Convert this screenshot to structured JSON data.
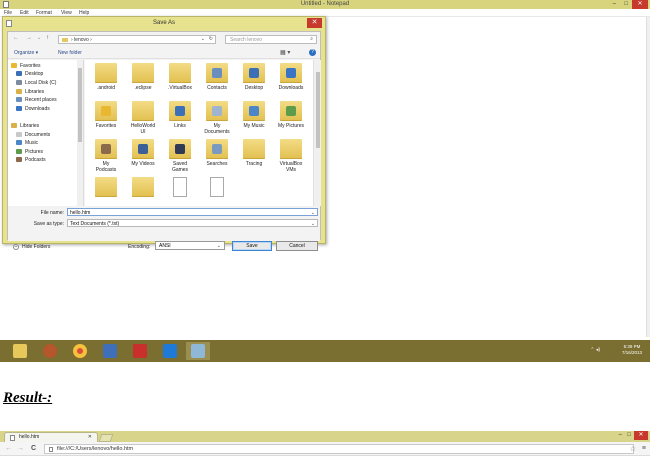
{
  "notepad": {
    "title": "Untitled - Notepad",
    "menu": [
      "File",
      "Edit",
      "Format",
      "View",
      "Help"
    ],
    "window_controls": {
      "minimize": "–",
      "maximize": "□",
      "close": "✕"
    }
  },
  "dialog": {
    "title": "Save As",
    "close": "✕",
    "nav": {
      "back": "←",
      "forward": "→",
      "history": "⌄",
      "up": "↑"
    },
    "address": {
      "path": "›  lenovo  ›",
      "dropdown": "⌄",
      "refresh": "↻"
    },
    "search": {
      "placeholder": "Search lenovo",
      "icon": "⌕"
    },
    "toolbar": {
      "organize": "Organize ▾",
      "new_folder": "New folder",
      "view": "▦ ▾",
      "help": "?"
    },
    "nav_pane": [
      {
        "label": "Favorites",
        "icon": "star-icon",
        "indent": 0
      },
      {
        "label": "Desktop",
        "icon": "desktop-icon",
        "indent": 1
      },
      {
        "label": "Local Disk (C)",
        "icon": "drive-icon",
        "indent": 1
      },
      {
        "label": "Libraries",
        "icon": "library-icon",
        "indent": 1
      },
      {
        "label": "Recent places",
        "icon": "recent-icon",
        "indent": 1
      },
      {
        "label": "Downloads",
        "icon": "downloads-icon",
        "indent": 1
      },
      {
        "label": "Libraries",
        "icon": "library-icon",
        "indent": 0
      },
      {
        "label": "Documents",
        "icon": "documents-icon",
        "indent": 1
      },
      {
        "label": "Music",
        "icon": "music-icon",
        "indent": 1
      },
      {
        "label": "Pictures",
        "icon": "pictures-icon",
        "indent": 1
      },
      {
        "label": "Podcasts",
        "icon": "podcasts-icon",
        "indent": 1
      }
    ],
    "files": [
      {
        "label": ".android",
        "icon": "folder-icon"
      },
      {
        "label": ".eclipse",
        "icon": "folder-icon"
      },
      {
        "label": ".VirtualBox",
        "icon": "folder-icon"
      },
      {
        "label": "Contacts",
        "icon": "contacts-folder-icon"
      },
      {
        "label": "Desktop",
        "icon": "desktop-folder-icon"
      },
      {
        "label": "Downloads",
        "icon": "downloads-folder-icon"
      },
      {
        "label": "Favorites",
        "icon": "favorites-folder-icon"
      },
      {
        "label": "HelloWorld\nUI",
        "icon": "folder-icon"
      },
      {
        "label": "Links",
        "icon": "links-folder-icon"
      },
      {
        "label": "My\nDocuments",
        "icon": "documents-folder-icon"
      },
      {
        "label": "My Music",
        "icon": "music-folder-icon"
      },
      {
        "label": "My Pictures",
        "icon": "pictures-folder-icon"
      },
      {
        "label": "My\nPodcasts",
        "icon": "podcasts-folder-icon"
      },
      {
        "label": "My Videos",
        "icon": "videos-folder-icon"
      },
      {
        "label": "Saved\nGames",
        "icon": "games-folder-icon"
      },
      {
        "label": "Searches",
        "icon": "searches-folder-icon"
      },
      {
        "label": "Tracing",
        "icon": "folder-icon"
      },
      {
        "label": "VirtualBox\nVMs",
        "icon": "folder-icon"
      },
      {
        "label": "",
        "icon": "folder-icon"
      },
      {
        "label": "",
        "icon": "folder-icon"
      },
      {
        "label": "",
        "icon": "file-icon"
      },
      {
        "label": "",
        "icon": "file-icon"
      }
    ],
    "file_name": {
      "label": "File name:",
      "value": "hello.htm",
      "dropdown": "⌄"
    },
    "save_type": {
      "label": "Save as type:",
      "value": "Text Documents (*.txt)",
      "dropdown": "⌄"
    },
    "hide_folders": "Hide Folders",
    "hide_folders_arrow": "⌃",
    "encoding": {
      "label": "Encoding:",
      "value": "ANSI",
      "dropdown": "⌄"
    },
    "save_button": "Save",
    "cancel_button": "Cancel"
  },
  "tray": {
    "icons": "⌃  ◂)",
    "time": "5:39 PM",
    "date": "7/16/2013"
  },
  "result_label": "Result-:",
  "browser": {
    "tab_title": "hello.htm",
    "tab_close": "✕",
    "controls": {
      "minimize": "–",
      "maximize": "□",
      "close": "✕"
    },
    "nav": {
      "back": "←",
      "forward": "→",
      "reload": "C"
    },
    "url": "file:///C:/Users/lenovo/hello.htm",
    "star": "☆",
    "menu": "≡"
  },
  "colors": {
    "titlebar": "#d8d47e",
    "dialog_frame": "#e6e28e",
    "taskbar": "#7a6e30",
    "close_red": "#c8392d",
    "folder_yellow": "#e7c85a"
  }
}
